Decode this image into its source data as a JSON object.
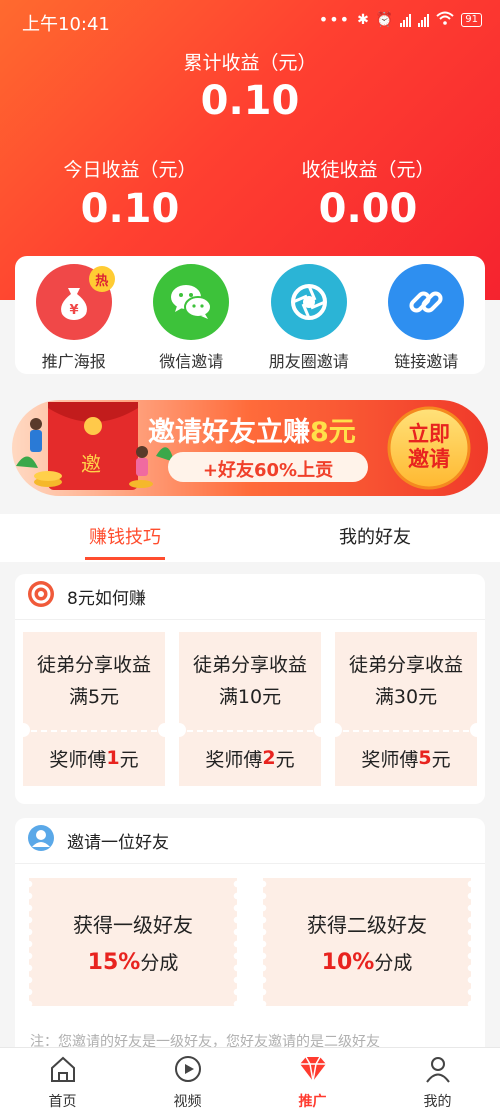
{
  "status_bar": {
    "time": "上午10:41",
    "dots": "•••",
    "battery": "91"
  },
  "earnings": {
    "total_label": "累计收益（元）",
    "total_value": "0.10",
    "today_label": "今日收益（元）",
    "today_value": "0.10",
    "apprentice_label": "收徒收益（元）",
    "apprentice_value": "0.00"
  },
  "actions": [
    {
      "label": "推广海报",
      "icon": "money-bag-icon",
      "color": "#f04848",
      "badge": "热"
    },
    {
      "label": "微信邀请",
      "icon": "wechat-icon",
      "color": "#3dc23a"
    },
    {
      "label": "朋友圈邀请",
      "icon": "moments-aperture-icon",
      "color": "#2bb4d6"
    },
    {
      "label": "链接邀请",
      "icon": "link-icon",
      "color": "#2e8ff0"
    }
  ],
  "banner": {
    "title_prefix": "邀请好友立赚",
    "title_amount": "8元",
    "subtitle": "+好友60%上贡",
    "button_line1": "立即",
    "button_line2": "邀请",
    "envelope_text": "邀"
  },
  "tabs": [
    {
      "label": "赚钱技巧",
      "active": true
    },
    {
      "label": "我的好友",
      "active": false
    }
  ],
  "section_earn": {
    "title": "8元如何赚",
    "tickets": [
      {
        "condition": "徒弟分享收益满5元",
        "reward_prefix": "奖师傅",
        "reward_amount": "1",
        "reward_suffix": "元"
      },
      {
        "condition": "徒弟分享收益满10元",
        "reward_prefix": "奖师傅",
        "reward_amount": "2",
        "reward_suffix": "元"
      },
      {
        "condition": "徒弟分享收益满30元",
        "reward_prefix": "奖师傅",
        "reward_amount": "5",
        "reward_suffix": "元"
      }
    ]
  },
  "section_invite": {
    "title": "邀请一位好友",
    "tickets": [
      {
        "line1": "获得一级好友",
        "percent": "15%",
        "suffix": "分成"
      },
      {
        "line1": "获得二级好友",
        "percent": "10%",
        "suffix": "分成"
      }
    ],
    "note": "注：您邀请的好友是一级好友，您好友邀请的是二级好友"
  },
  "bottom_nav": [
    {
      "label": "首页",
      "icon": "home-icon",
      "active": false
    },
    {
      "label": "视频",
      "icon": "video-play-icon",
      "active": false
    },
    {
      "label": "推广",
      "icon": "diamond-icon",
      "active": true
    },
    {
      "label": "我的",
      "icon": "profile-icon",
      "active": false
    }
  ],
  "colors": {
    "header_start": "#ff6a2f",
    "header_end": "#f5232f",
    "accent": "#ff4d2e",
    "ticket_bg": "#fdeee6",
    "reward_red": "#e8231f"
  }
}
